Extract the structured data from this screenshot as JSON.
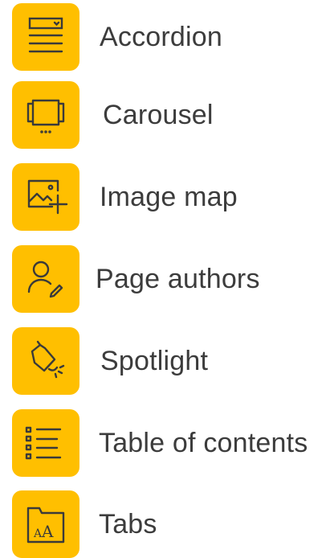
{
  "colors": {
    "accent": "#FFBF00",
    "icon_stroke": "#3a3a3a",
    "text": "#3c3c3c"
  },
  "items": [
    {
      "label": "Accordion",
      "icon": "accordion-icon"
    },
    {
      "label": "Carousel",
      "icon": "carousel-icon"
    },
    {
      "label": "Image map",
      "icon": "image-map-icon"
    },
    {
      "label": "Page authors",
      "icon": "page-authors-icon"
    },
    {
      "label": "Spotlight",
      "icon": "spotlight-icon"
    },
    {
      "label": "Table of contents",
      "icon": "table-of-contents-icon"
    },
    {
      "label": "Tabs",
      "icon": "tabs-icon"
    }
  ]
}
